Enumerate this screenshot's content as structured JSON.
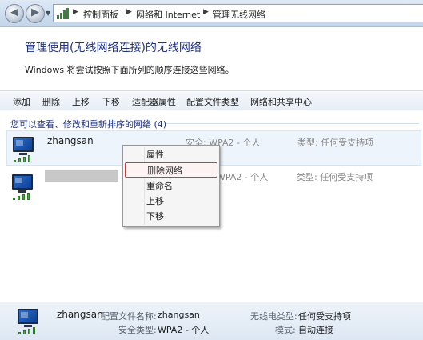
{
  "breadcrumb": {
    "items": [
      "控制面板",
      "网络和 Internet",
      "管理无线网络"
    ]
  },
  "header": {
    "title": "管理使用(无线网络连接)的无线网络",
    "description": "Windows 将尝试按照下面所列的顺序连接这些网络。"
  },
  "toolbar": {
    "items": [
      "添加",
      "删除",
      "上移",
      "下移",
      "适配器属性",
      "配置文件类型",
      "网络和共享中心"
    ]
  },
  "list": {
    "header": "您可以查看、修改和重新排序的网络 (4)",
    "networks": [
      {
        "name": "zhangsan",
        "security": "安全: WPA2 - 个人",
        "type": "类型: 任何受支持项",
        "selected": true
      },
      {
        "name": "",
        "security": "WPA2 - 个人",
        "type": "类型: 任何受支持项",
        "selected": false
      }
    ]
  },
  "context_menu": {
    "items": [
      "属性",
      "删除网络",
      "重命名",
      "上移",
      "下移"
    ],
    "highlighted": "删除网络"
  },
  "details": {
    "name": "zhangsan",
    "profile_label": "配置文件名称:",
    "profile_value": "zhangsan",
    "security_label": "安全类型:",
    "security_value": "WPA2 - 个人",
    "radio_label": "无线电类型:",
    "radio_value": "任何受支持项",
    "mode_label": "模式:",
    "mode_value": "自动连接"
  },
  "colors": {
    "title_blue": "#1e3287",
    "highlight_border": "#d23a3a"
  }
}
